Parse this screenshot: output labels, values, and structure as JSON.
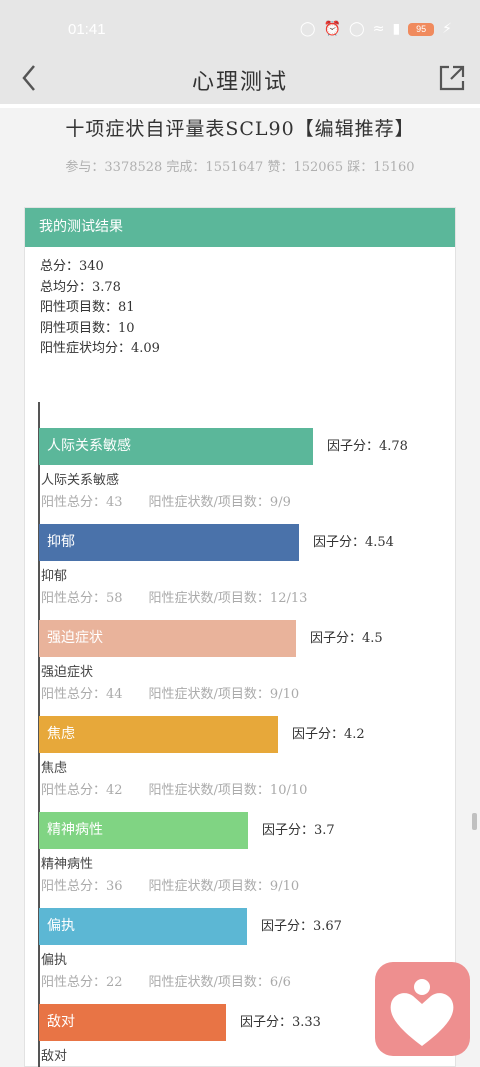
{
  "status": {
    "time": "01:41",
    "battery": "95"
  },
  "nav": {
    "title": "心理测试"
  },
  "page": {
    "title": "十项症状自评量表SCL90【编辑推荐】",
    "stats": "参与：3378528 完成：1551647 赞：152065 踩：15160"
  },
  "result": {
    "header": "我的测试结果",
    "summary": [
      "总分：340",
      "总均分：3.78",
      "阳性项目数：81",
      "阴性项目数：10",
      "阳性症状均分：4.09"
    ]
  },
  "chart_data": {
    "type": "bar",
    "orientation": "horizontal",
    "categories": [
      "人际关系敏感",
      "抑郁",
      "强迫症状",
      "焦虑",
      "精神病性",
      "偏执",
      "敌对"
    ],
    "values": [
      4.78,
      4.54,
      4.5,
      4.2,
      3.7,
      3.67,
      3.33
    ],
    "factor_labels": [
      "因子分：4.78",
      "因子分：4.54",
      "因子分：4.5",
      "因子分：4.2",
      "因子分：3.7",
      "因子分：3.67",
      "因子分：3.33"
    ],
    "positive_totals": [
      "阳性总分：43",
      "阳性总分：58",
      "阳性总分：44",
      "阳性总分：42",
      "阳性总分：36",
      "阳性总分：22",
      ""
    ],
    "positive_counts": [
      "阳性症状数/项目数：9/9",
      "阳性症状数/项目数：12/13",
      "阳性症状数/项目数：9/10",
      "阳性症状数/项目数：10/10",
      "阳性症状数/项目数：9/10",
      "阳性症状数/项目数：6/6",
      ""
    ],
    "colors": [
      "#5bb79a",
      "#4a72aa",
      "#e9b39b",
      "#e7a83a",
      "#80d483",
      "#5cb7d4",
      "#e87445"
    ],
    "xlim": [
      0,
      5
    ]
  }
}
